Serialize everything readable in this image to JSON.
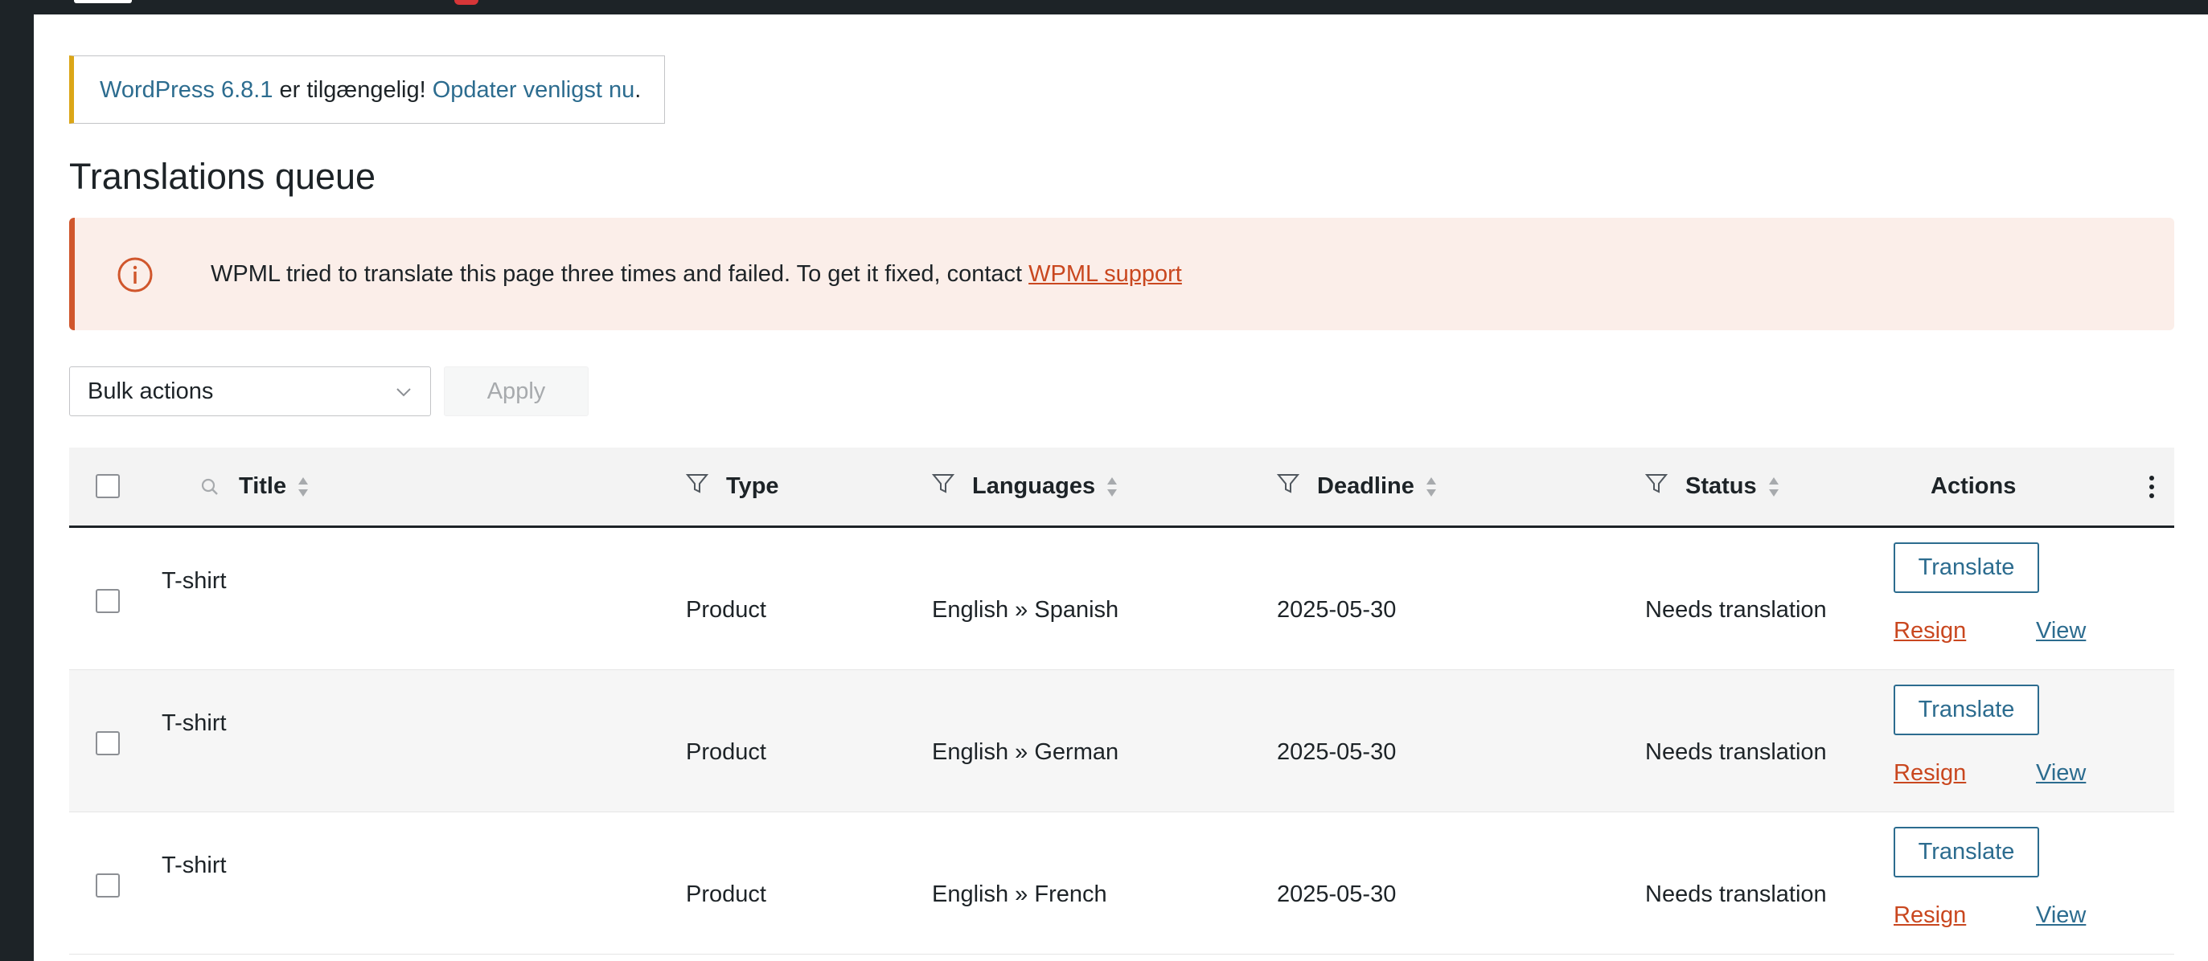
{
  "update_nag": {
    "version_link": "WordPress 6.8.1",
    "middle_text": " er tilgængelig! ",
    "update_link": "Opdater venligst nu",
    "end_text": "."
  },
  "page": {
    "title": "Translations queue"
  },
  "error_notice": {
    "message": "WPML tried to translate this page three times and failed. To get it fixed, contact ",
    "support_link": "WPML support",
    "icon": "info-circle-icon",
    "accent_color": "#d0562c"
  },
  "bulk": {
    "select_value": "Bulk actions",
    "apply_label": "Apply"
  },
  "table": {
    "columns": {
      "title": "Title",
      "type": "Type",
      "languages": "Languages",
      "deadline": "Deadline",
      "status": "Status",
      "actions": "Actions"
    },
    "rows": [
      {
        "title": "T-shirt",
        "type": "Product",
        "languages": "English » Spanish",
        "deadline": "2025-05-30",
        "status": "Needs translation",
        "translate": "Translate",
        "resign": "Resign",
        "view": "View"
      },
      {
        "title": "T-shirt",
        "type": "Product",
        "languages": "English » German",
        "deadline": "2025-05-30",
        "status": "Needs translation",
        "translate": "Translate",
        "resign": "Resign",
        "view": "View"
      },
      {
        "title": "T-shirt",
        "type": "Product",
        "languages": "English » French",
        "deadline": "2025-05-30",
        "status": "Needs translation",
        "translate": "Translate",
        "resign": "Resign",
        "view": "View"
      }
    ]
  },
  "colors": {
    "link": "#2c6c8f",
    "danger": "#c9471f",
    "nag_accent": "#dba617"
  }
}
